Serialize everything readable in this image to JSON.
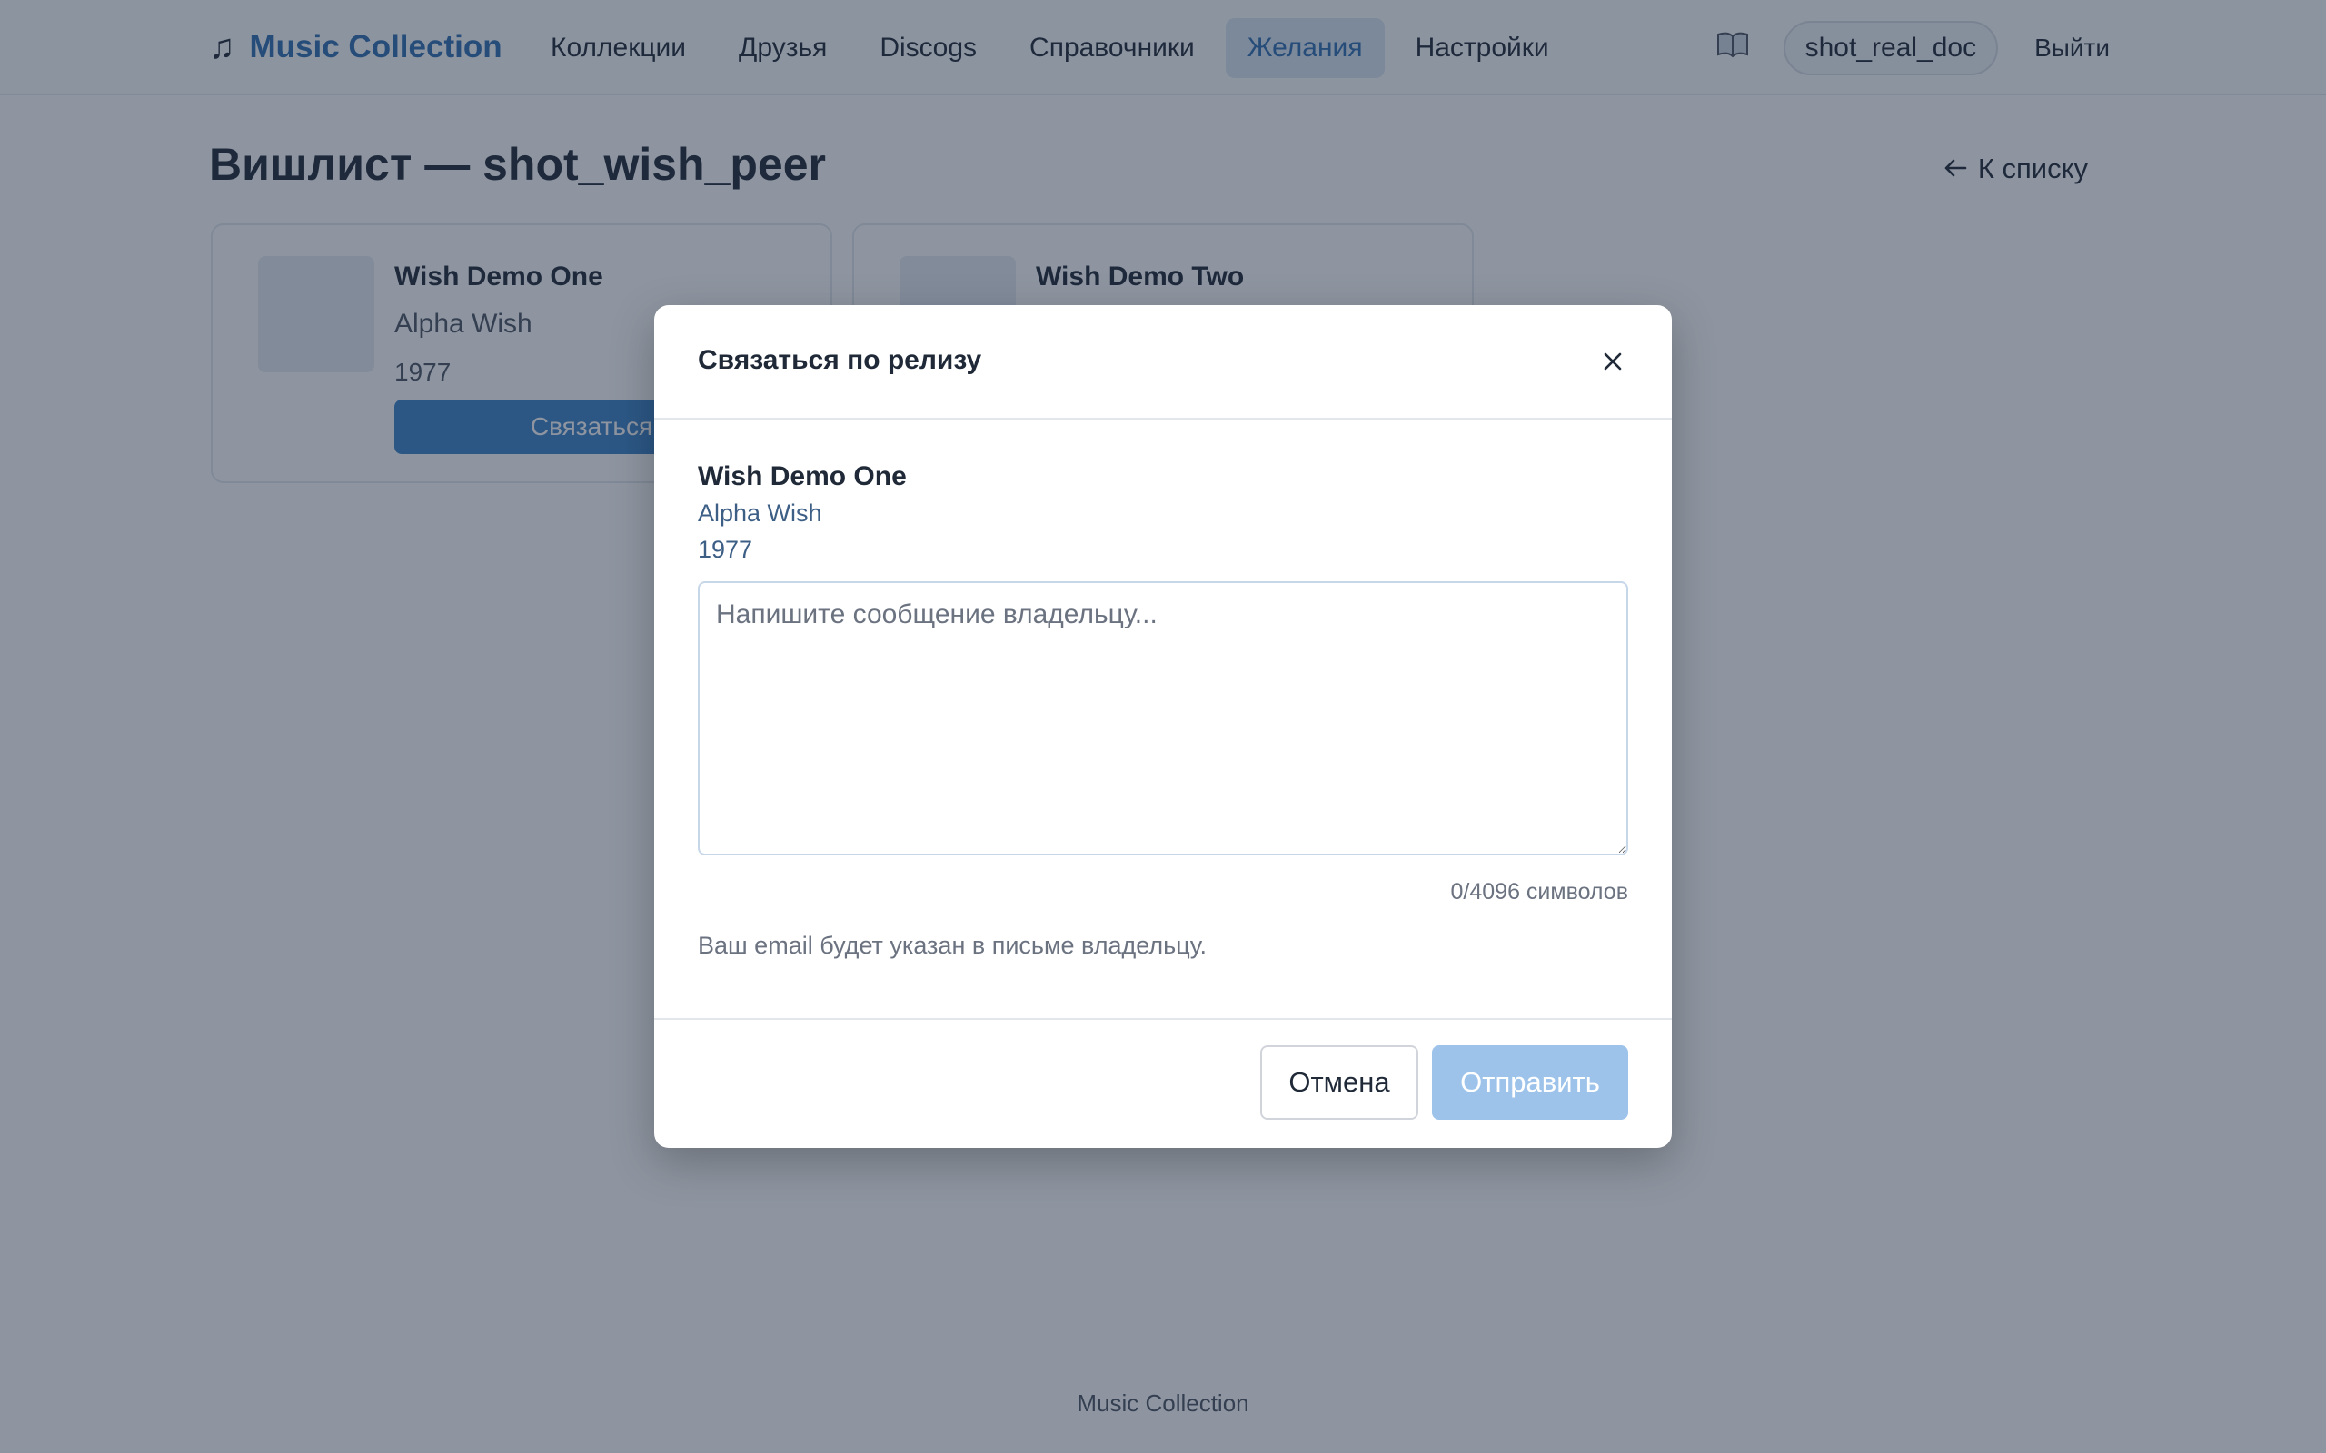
{
  "brand": {
    "icon": "music-note-icon",
    "name": "Music Collection"
  },
  "nav": {
    "items": [
      {
        "label": "Коллекции"
      },
      {
        "label": "Друзья"
      },
      {
        "label": "Discogs"
      },
      {
        "label": "Справочники"
      },
      {
        "label": "Желания",
        "active": true
      },
      {
        "label": "Настройки"
      }
    ],
    "help_icon": "book-icon",
    "username": "shot_real_doc",
    "logout": "Выйти"
  },
  "page": {
    "title": "Вишлист — shot_wish_peer",
    "back_link": "К списку",
    "back_icon": "arrow-left-icon"
  },
  "wishlist": [
    {
      "title": "Wish Demo One",
      "artist": "Alpha Wish",
      "year": "1977",
      "contact_label": "Связаться"
    },
    {
      "title": "Wish Demo Two"
    }
  ],
  "modal": {
    "title": "Связаться по релизу",
    "release": {
      "title": "Wish Demo One",
      "artist": "Alpha Wish",
      "year": "1977"
    },
    "message": {
      "value": "",
      "placeholder": "Напишите сообщение владельцу..."
    },
    "counter": "0/4096 символов",
    "email_note": "Ваш email будет указан в письме владельцу.",
    "cancel": "Отмена",
    "send": "Отправить"
  },
  "footer": {
    "text": "Music Collection"
  },
  "colors": {
    "accent": "#2f6db0",
    "primary_button": "#3b82c8",
    "disabled_button": "#9dc3ea"
  }
}
